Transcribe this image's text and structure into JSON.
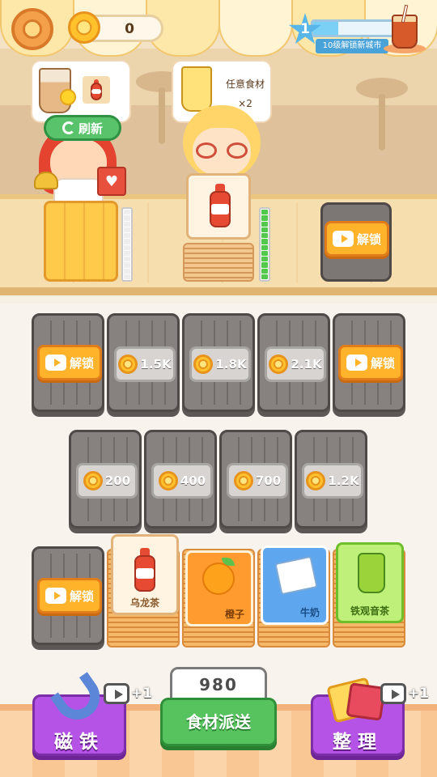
{
  "hud": {
    "coins": "0",
    "level": "1",
    "level_progress": 0.3,
    "level_tip": "10级解锁新城市",
    "icons": {
      "settings": "gear-icon",
      "coin": "coin-icon",
      "level": "star-icon",
      "reward": "iced-tea-icon"
    }
  },
  "customers": [
    {
      "order_icons": [
        "milk-tea-icon",
        "oolong-tea-bottle-icon"
      ],
      "refresh_label": "刷新"
    },
    {
      "order_icon": "golden-drink-icon",
      "order_text": "任意食材",
      "order_multiplier": "×2"
    }
  ],
  "counter": {
    "slot1_progress": 0,
    "slot2_progress": 1,
    "locked_label": "解锁"
  },
  "grid": {
    "row1": [
      {
        "type": "ad",
        "label": "解锁"
      },
      {
        "type": "price",
        "price": "1.5K"
      },
      {
        "type": "price",
        "price": "1.8K"
      },
      {
        "type": "price",
        "price": "2.1K"
      },
      {
        "type": "ad",
        "label": "解锁"
      }
    ],
    "row2": [
      {
        "type": "price",
        "price": "200"
      },
      {
        "type": "price",
        "price": "400"
      },
      {
        "type": "price",
        "price": "700"
      },
      {
        "type": "price",
        "price": "1.2K"
      }
    ],
    "row3_locked_label": "解锁"
  },
  "ingredients": [
    {
      "name": "乌龙茶",
      "icon": "oolong-tea-bottle-icon",
      "color": "#f2c88e"
    },
    {
      "name": "橙子",
      "icon": "orange-icon",
      "color": "#ff9b2f"
    },
    {
      "name": "牛奶",
      "icon": "milk-carton-icon",
      "color": "#5ea6ee"
    },
    {
      "name": "铁观音茶",
      "icon": "tea-jar-icon",
      "color": "#8fd63c"
    }
  ],
  "bottom": {
    "magnet_label": "磁铁",
    "magnet_bonus": "+1",
    "deliver_count": "980",
    "deliver_label": "食材派送",
    "sort_label": "整理",
    "sort_bonus": "+1"
  }
}
